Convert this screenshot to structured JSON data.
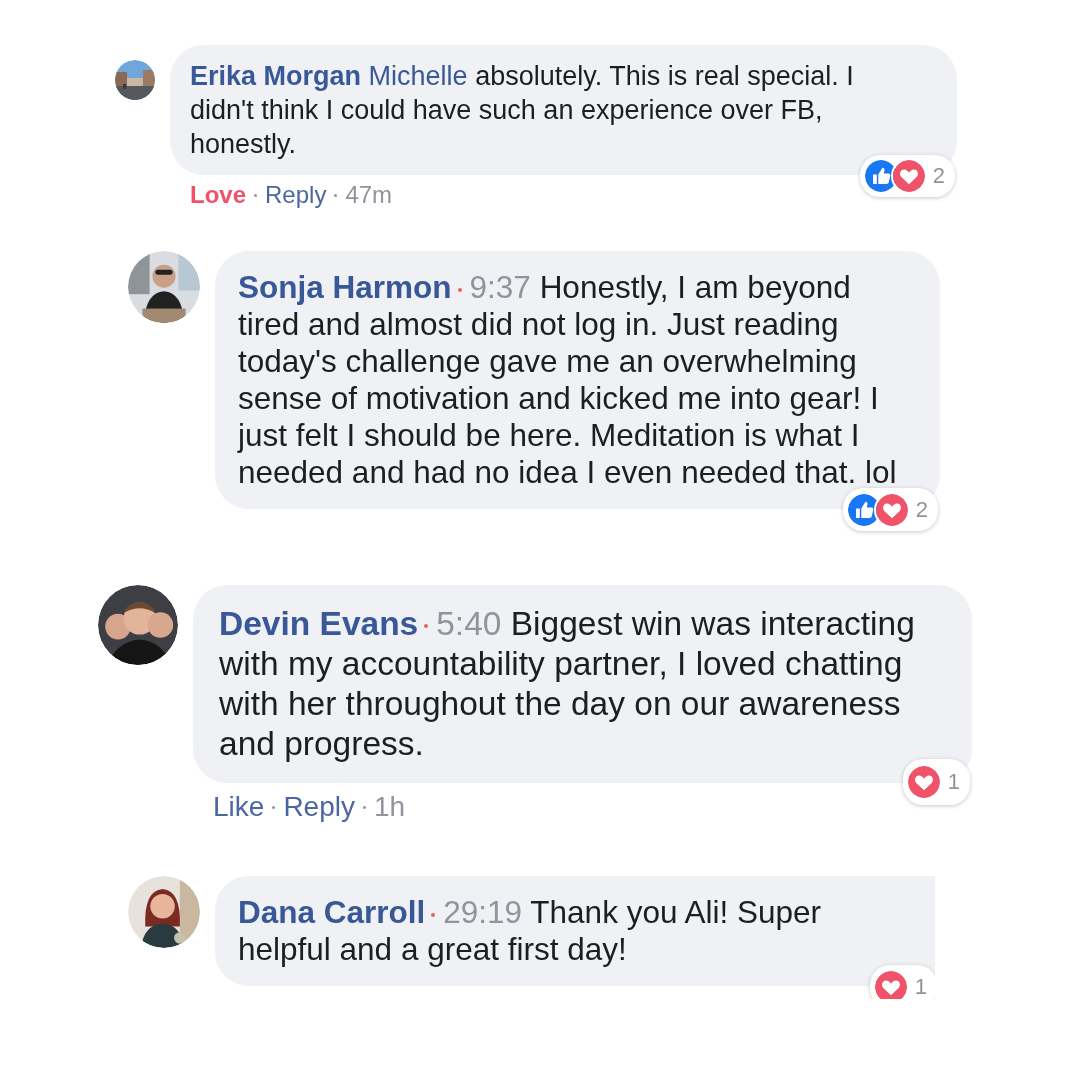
{
  "comments": [
    {
      "author": "Erika Morgan",
      "mention": "Michelle",
      "text": "absolutely. This is real special. I didn't think I could have such an experience over FB, honestly.",
      "reactions": {
        "icons": [
          {
            "kind": "like"
          },
          {
            "kind": "love"
          }
        ],
        "count": "2"
      },
      "actions": {
        "reaction": {
          "label": "Love",
          "selected": true
        },
        "reply": "Reply",
        "time": "47m"
      }
    },
    {
      "author": "Sonja Harmon",
      "timestamp": "9:37",
      "text": "Honestly, I am beyond tired and almost did not log in. Just reading today's challenge gave me an overwhelming sense of motivation and kicked me into gear! I just felt I should be here. Meditation is what I needed and had no idea I even needed that. lol",
      "reactions": {
        "icons": [
          {
            "kind": "like"
          },
          {
            "kind": "love"
          }
        ],
        "count": "2"
      }
    },
    {
      "author": "Devin Evans",
      "timestamp": "5:40",
      "text": "Biggest win was interacting with my accountability partner, I loved chatting with her throughout the day on our awareness and progress.",
      "reactions": {
        "icons": [
          {
            "kind": "love"
          }
        ],
        "count": "1"
      },
      "actions": {
        "reaction": {
          "label": "Like",
          "selected": false
        },
        "reply": "Reply",
        "time": "1h"
      }
    },
    {
      "author": "Dana Carroll",
      "timestamp": "29:19",
      "text": "Thank you Ali! Super helpful and a great first day!",
      "reactions": {
        "icons": [
          {
            "kind": "love"
          }
        ],
        "count": "1"
      }
    }
  ]
}
